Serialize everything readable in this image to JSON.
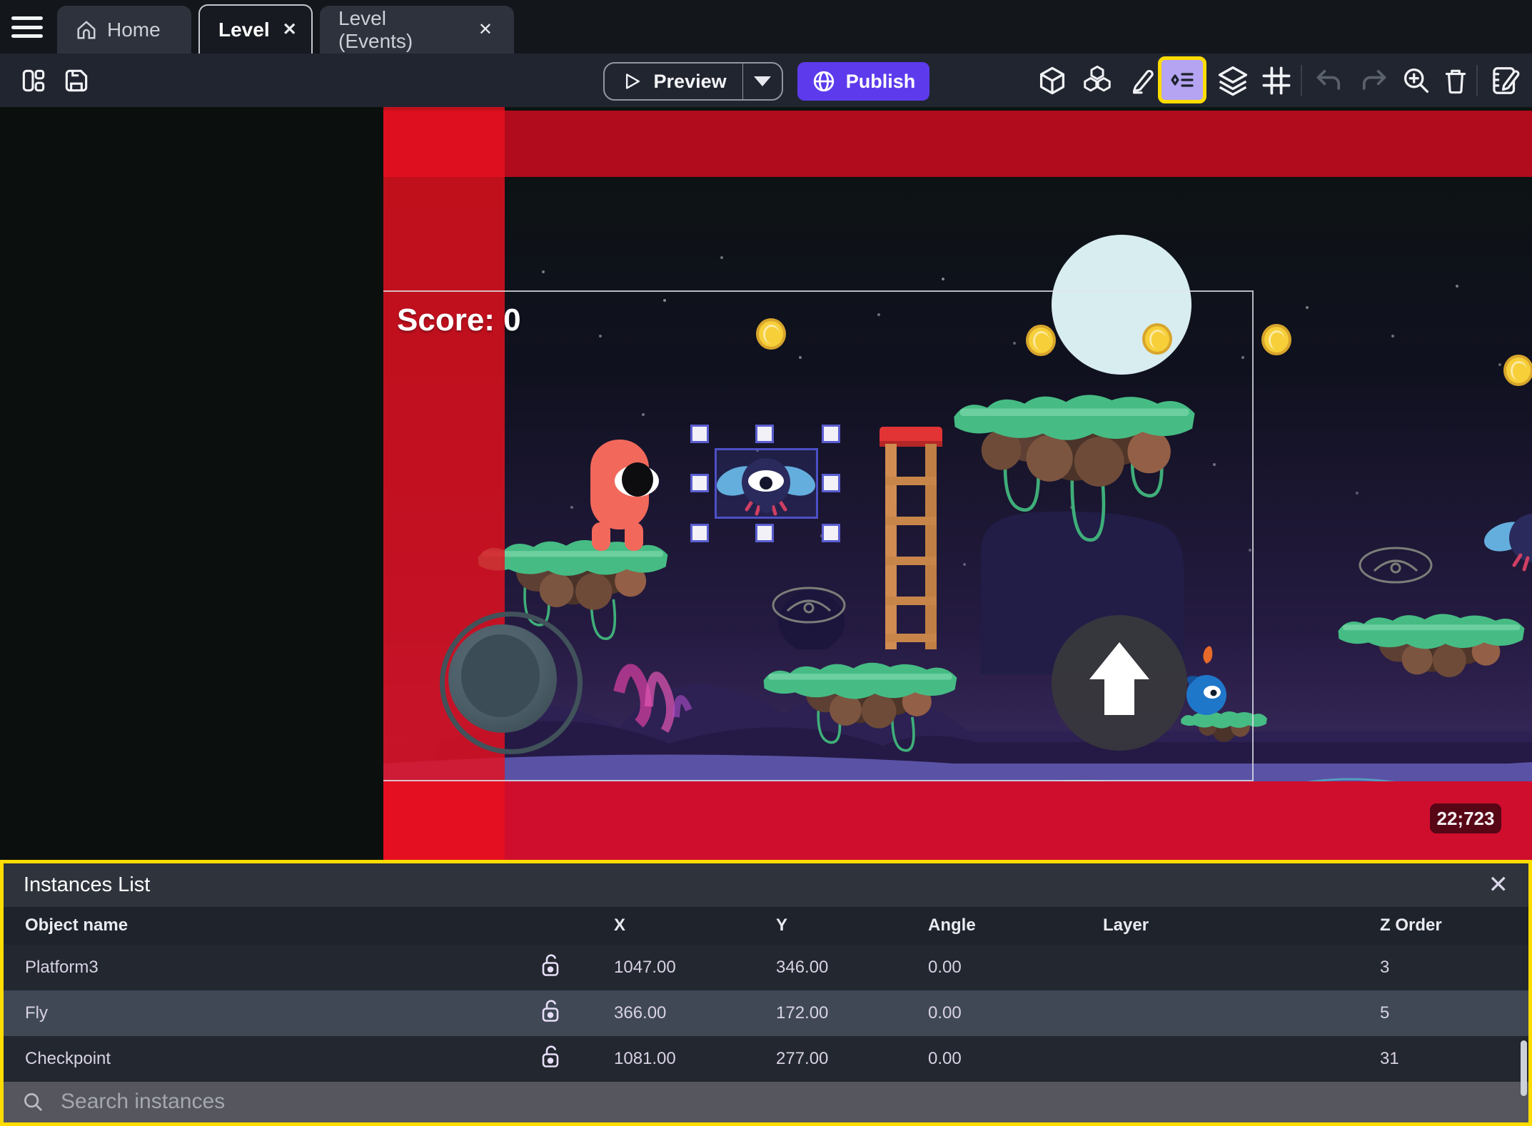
{
  "tabbar": {
    "home_label": "Home",
    "level_label": "Level",
    "events_label": "Level (Events)"
  },
  "toolbar": {
    "preview_label": "Preview",
    "publish_label": "Publish"
  },
  "scene": {
    "score_text": "Score: 0",
    "coords_badge": "22;723"
  },
  "instances_panel": {
    "title": "Instances List",
    "columns": [
      "Object name",
      "X",
      "Y",
      "Angle",
      "Layer",
      "Z Order"
    ],
    "rows": [
      {
        "name": "Platform3",
        "x": "1047.00",
        "y": "346.00",
        "angle": "0.00",
        "layer": "",
        "z_order": "3"
      },
      {
        "name": "Fly",
        "x": "366.00",
        "y": "172.00",
        "angle": "0.00",
        "layer": "",
        "z_order": "5"
      },
      {
        "name": "Checkpoint",
        "x": "1081.00",
        "y": "277.00",
        "angle": "0.00",
        "layer": "",
        "z_order": "31"
      }
    ],
    "selected_row": "Fly",
    "search_placeholder": "Search instances"
  },
  "icons": {
    "close_glyph": "✕",
    "names": [
      "hamburger-icon",
      "home-icon",
      "layout-panels-icon",
      "save-icon",
      "play-icon",
      "caret-down-icon",
      "globe-icon",
      "cube-icon",
      "object-groups-icon",
      "pencil-icon",
      "instances-list-icon",
      "layers-icon",
      "grid-icon",
      "undo-icon",
      "redo-icon",
      "zoom-in-icon",
      "trash-icon",
      "edit-scene-icon",
      "lock-open-icon",
      "search-icon",
      "close-icon"
    ]
  },
  "colors": {
    "accent_purple": "#5d3bec",
    "highlight_yellow": "#ffdc00",
    "instances_icon_bg": "#b4a4f2",
    "selected_row_bg": "#404856",
    "red_strip": "#e8101f",
    "top_band_red": "#b00c1d",
    "bottom_red": "#cf0e2d",
    "panel_bg": "#272b33"
  }
}
